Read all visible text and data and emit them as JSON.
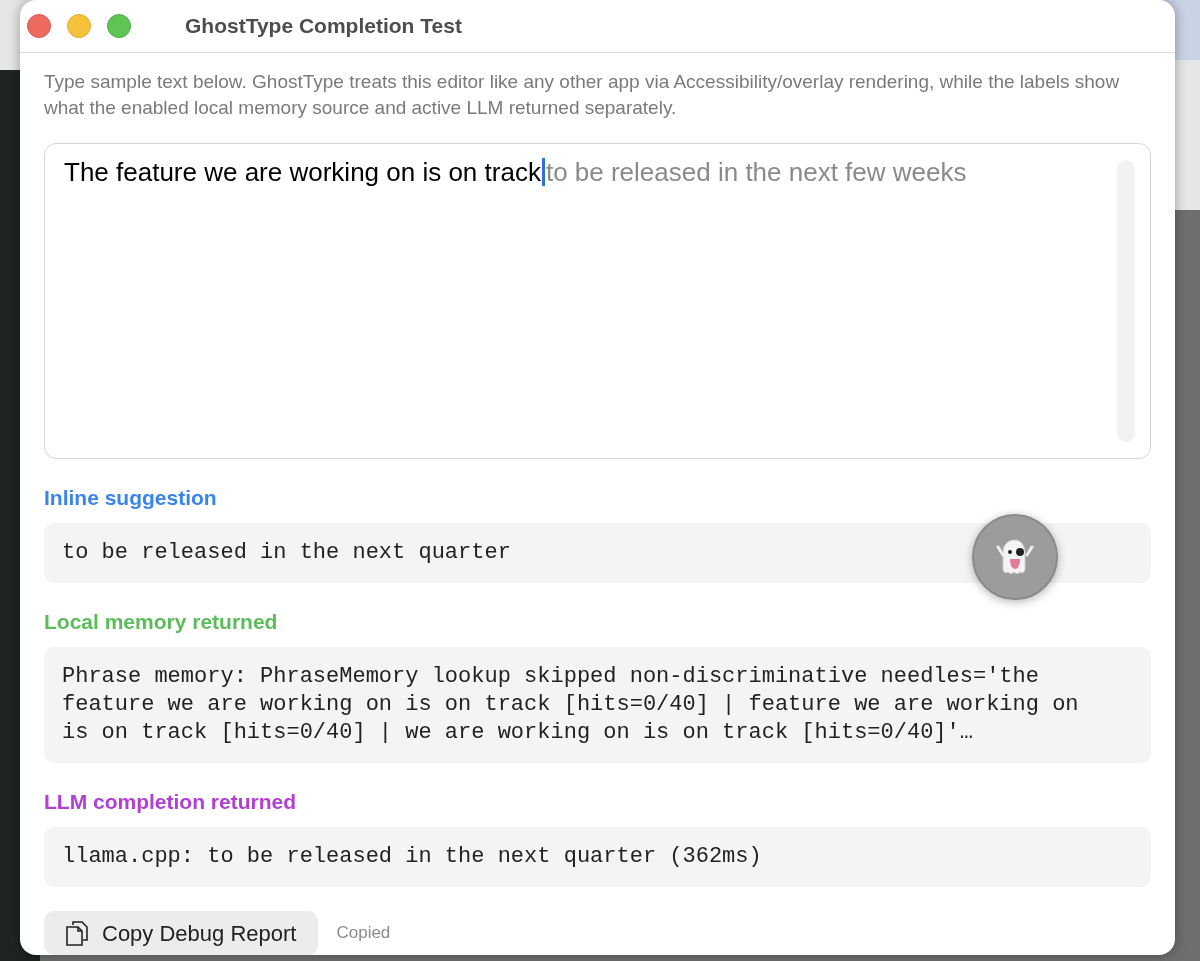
{
  "window": {
    "title": "GhostType Completion Test"
  },
  "description": "Type sample text below. GhostType treats this editor like any other app via Accessibility/overlay rendering, while the labels show what the enabled local memory source and active LLM returned separately.",
  "editor": {
    "value": "The feature we are working on is on track",
    "suggestion": "to be released in the next few weeks"
  },
  "sections": [
    {
      "label": "Inline suggestion",
      "color": "#3a84f0",
      "lines": [
        "to be released in the next quarter"
      ]
    },
    {
      "label": "Local memory returned",
      "color": "#5bbd5a",
      "lines": [
        "Phrase memory: PhraseMemory lookup skipped non-discriminative needles='the",
        "feature we are working on is on track [hits=0/40] | feature we are working on",
        "is on track [hits=0/40] | we are working on is on track [hits=0/40]'…"
      ]
    },
    {
      "label": "LLM completion returned",
      "color": "#b23fd4",
      "lines": [
        "llama.cpp: to be released in the next quarter (362ms)"
      ]
    }
  ],
  "copy_button": {
    "label": "Copy Debug Report"
  },
  "copy_status": "Copied"
}
